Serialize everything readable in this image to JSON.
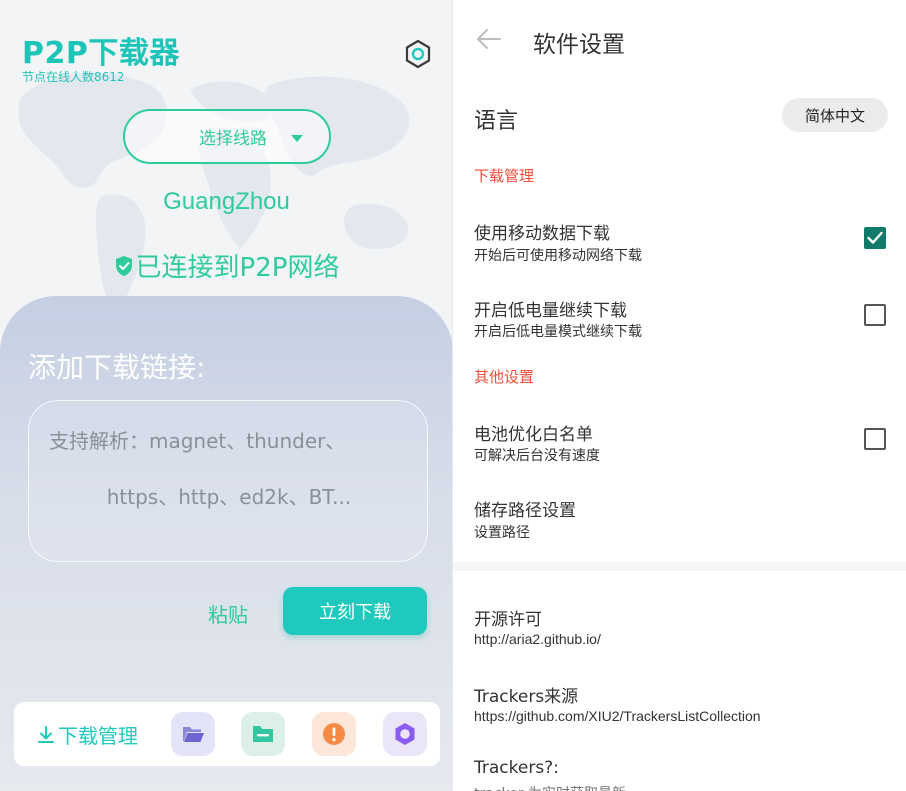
{
  "main": {
    "app_title": "P2P下载器",
    "online_nodes": "节点在线人数8612",
    "route_select_label": "选择线路",
    "location": "GuangZhou",
    "connection_status": "已连接到P2P网络",
    "add_link_title": "添加下载链接:",
    "link_placeholder_line1": "支持解析：magnet、thunder、",
    "link_placeholder_line2": "https、http、ed2k、BT...",
    "paste_label": "粘贴",
    "download_now_label": "立刻下载",
    "download_manager_label": "下载管理",
    "accent_color": "#1fc9bd"
  },
  "settings": {
    "title": "软件设置",
    "language": {
      "label": "语言",
      "value": "简体中文"
    },
    "sections": {
      "download": "下载管理",
      "other": "其他设置"
    },
    "items": [
      {
        "title": "使用移动数据下载",
        "subtitle": "开始后可使用移动网络下载",
        "checked": true
      },
      {
        "title": "开启低电量继续下载",
        "subtitle": "开启后低电量模式继续下载",
        "checked": false
      },
      {
        "title": "电池优化白名单",
        "subtitle": "可解决后台没有速度",
        "checked": false
      },
      {
        "title": "储存路径设置",
        "subtitle": "设置路径"
      }
    ],
    "about": [
      {
        "title": "开源许可",
        "subtitle": "http://aria2.github.io/"
      },
      {
        "title": "Trackers来源",
        "subtitle": "https://github.com/XIU2/TrackersListCollection"
      },
      {
        "title": "Trackers?:",
        "subtitle": "tracker 为实时获取最新"
      }
    ],
    "warning_color": "#f04e3a",
    "check_color": "#117a6a"
  }
}
